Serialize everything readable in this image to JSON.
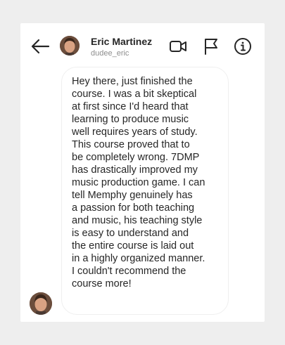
{
  "header": {
    "back_icon": "arrow-left-icon",
    "name": "Eric Martinez",
    "handle": "dudee_eric",
    "icons": [
      "video-camera-icon",
      "flag-icon",
      "info-icon"
    ]
  },
  "message": {
    "text": "Hey there, just finished the\ncourse. I was a bit skeptical\nat first since I'd heard that\nlearning to produce music\nwell requires years of study.\nThis course proved that to\nbe completely wrong. 7DMP\nhas drastically improved my\nmusic production game. I can\ntell Memphy genuinely has\na passion for both teaching\nand music, his teaching style\nis easy to understand and\nthe entire course is laid out\nin a highly organized manner.\nI couldn't recommend the\ncourse more!"
  },
  "colors": {
    "background": "#eeeeee",
    "card": "#ffffff",
    "text": "#262626",
    "muted": "#8e8e8e",
    "bubble_border": "#efefef"
  }
}
